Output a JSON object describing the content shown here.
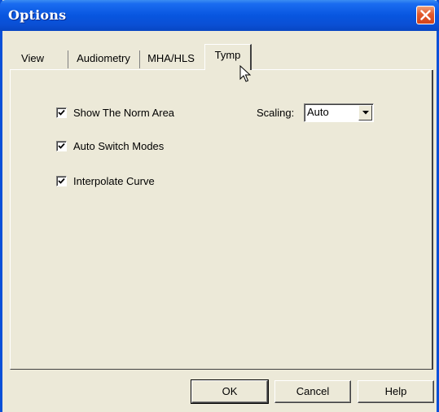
{
  "window": {
    "title": "Options"
  },
  "tabs": [
    {
      "label": "View"
    },
    {
      "label": "Audiometry"
    },
    {
      "label": "MHA/HLS"
    },
    {
      "label": "Tymp",
      "active": true
    }
  ],
  "tymp_panel": {
    "show_norm_area": {
      "label": "Show The Norm Area",
      "checked": true
    },
    "auto_switch_modes": {
      "label": "Auto Switch Modes",
      "checked": true
    },
    "interpolate_curve": {
      "label": "Interpolate Curve",
      "checked": true
    },
    "scaling": {
      "label": "Scaling:",
      "value": "Auto"
    }
  },
  "buttons": {
    "ok": "OK",
    "cancel": "Cancel",
    "help": "Help"
  },
  "icons": {
    "close": "close-icon",
    "checkmark": "checkmark-icon",
    "dropdown": "chevron-down-icon",
    "cursor": "mouse-cursor-icon"
  },
  "colors": {
    "title_bar": "#0856e0",
    "dialog_bg": "#ece9d8",
    "close_button": "#e2592c"
  }
}
